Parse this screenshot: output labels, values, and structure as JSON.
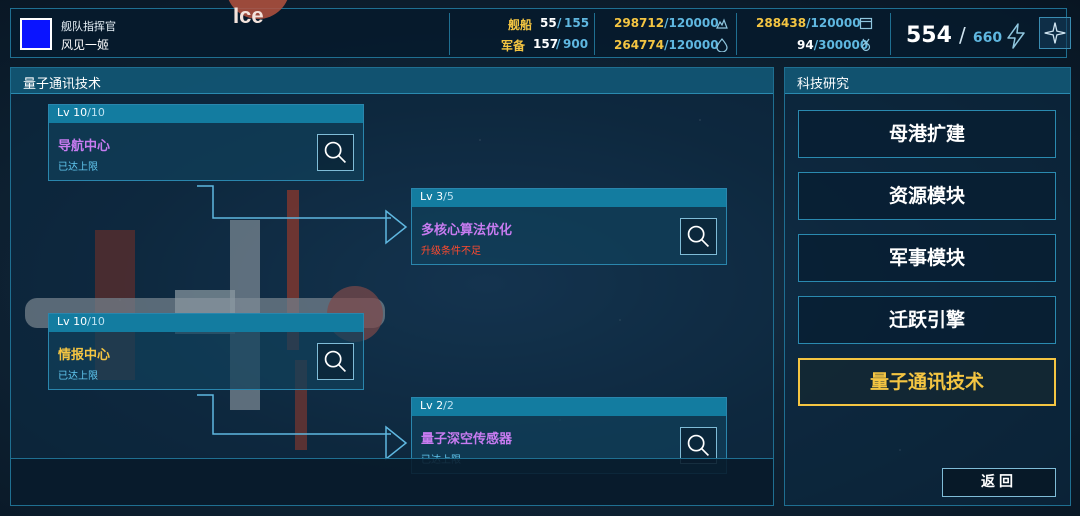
{
  "header": {
    "commander_title": "舰队指挥官",
    "commander_name": "风见一姬",
    "ships_label": "舰船",
    "ships_cur": "55",
    "ships_max": "155",
    "reserve_label": "军备",
    "reserve_cur": "157",
    "reserve_max": "900",
    "res1_cur": "298712",
    "res1_max": "120000",
    "res2_cur": "264774",
    "res2_max": "120000",
    "res3_cur": "288438",
    "res3_max": "120000",
    "res4_cur": "94",
    "res4_max": "300000",
    "energy_cur": "554",
    "energy_sep": "/",
    "energy_max": "660",
    "icons": [
      "ore-icon",
      "fuel-drop-icon",
      "calendar-icon",
      "medal-icon",
      "lightning-icon",
      "boost-icon"
    ]
  },
  "tech_tree": {
    "title": "量子通讯技术",
    "nodes": [
      {
        "lv_prefix": "Lv ",
        "lv_cur": "10",
        "lv_max": "/10",
        "name": "导航中心",
        "status": "已达上限"
      },
      {
        "lv_prefix": "Lv ",
        "lv_cur": "3",
        "lv_max": "/5",
        "name": "多核心算法优化",
        "status": "升级条件不足"
      },
      {
        "lv_prefix": "Lv ",
        "lv_cur": "10",
        "lv_max": "/10",
        "name": "情报中心",
        "status": "已达上限"
      },
      {
        "lv_prefix": "Lv ",
        "lv_cur": "2",
        "lv_max": "/2",
        "name": "量子深空传感器",
        "status": "已达上限"
      }
    ]
  },
  "sidebar": {
    "title": "科技研究",
    "items": [
      "母港扩建",
      "资源模块",
      "军事模块",
      "迁跃引擎",
      "量子通讯技术"
    ],
    "active": "量子通讯技术",
    "back_label": "返回"
  },
  "colors": {
    "accent_yellow": "#f4c542",
    "accent_blue": "#5fb7e0",
    "status_red": "#ff4a2e",
    "node_purple": "#c77bf0",
    "panel_border": "#1f6f91"
  }
}
